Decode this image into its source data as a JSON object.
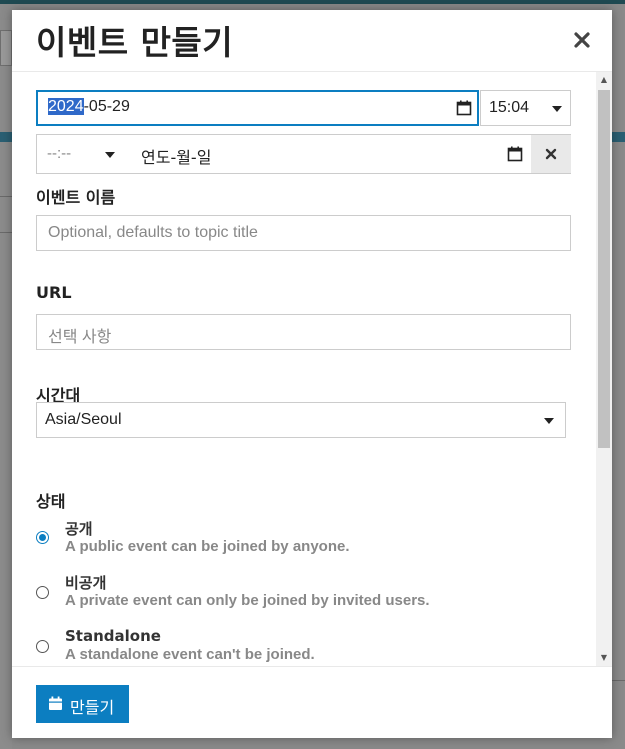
{
  "modal": {
    "title": "이벤트 만들기",
    "close_icon": "close-icon"
  },
  "start": {
    "date_year": "2024",
    "date_rest": "-05-29",
    "time": "15:04"
  },
  "end": {
    "time_placeholder": "--:--",
    "date_placeholder": "연도-월-일"
  },
  "fields": {
    "event_name_label": "이벤트 이름",
    "event_name_placeholder": "Optional, defaults to topic title",
    "url_label": "URL",
    "url_placeholder": "선택 사항",
    "timezone_label": "시간대",
    "timezone_value": "Asia/Seoul",
    "status_label": "상태"
  },
  "status_options": [
    {
      "title": "공개",
      "desc": "A public event can be joined by anyone.",
      "checked": true
    },
    {
      "title": "비공개",
      "desc": "A private event can only be joined by invited users.",
      "checked": false
    },
    {
      "title": "Standalone",
      "desc": "A standalone event can't be joined.",
      "checked": false
    }
  ],
  "footer": {
    "create_label": "만들기"
  },
  "colors": {
    "accent": "#0c7ec1"
  }
}
